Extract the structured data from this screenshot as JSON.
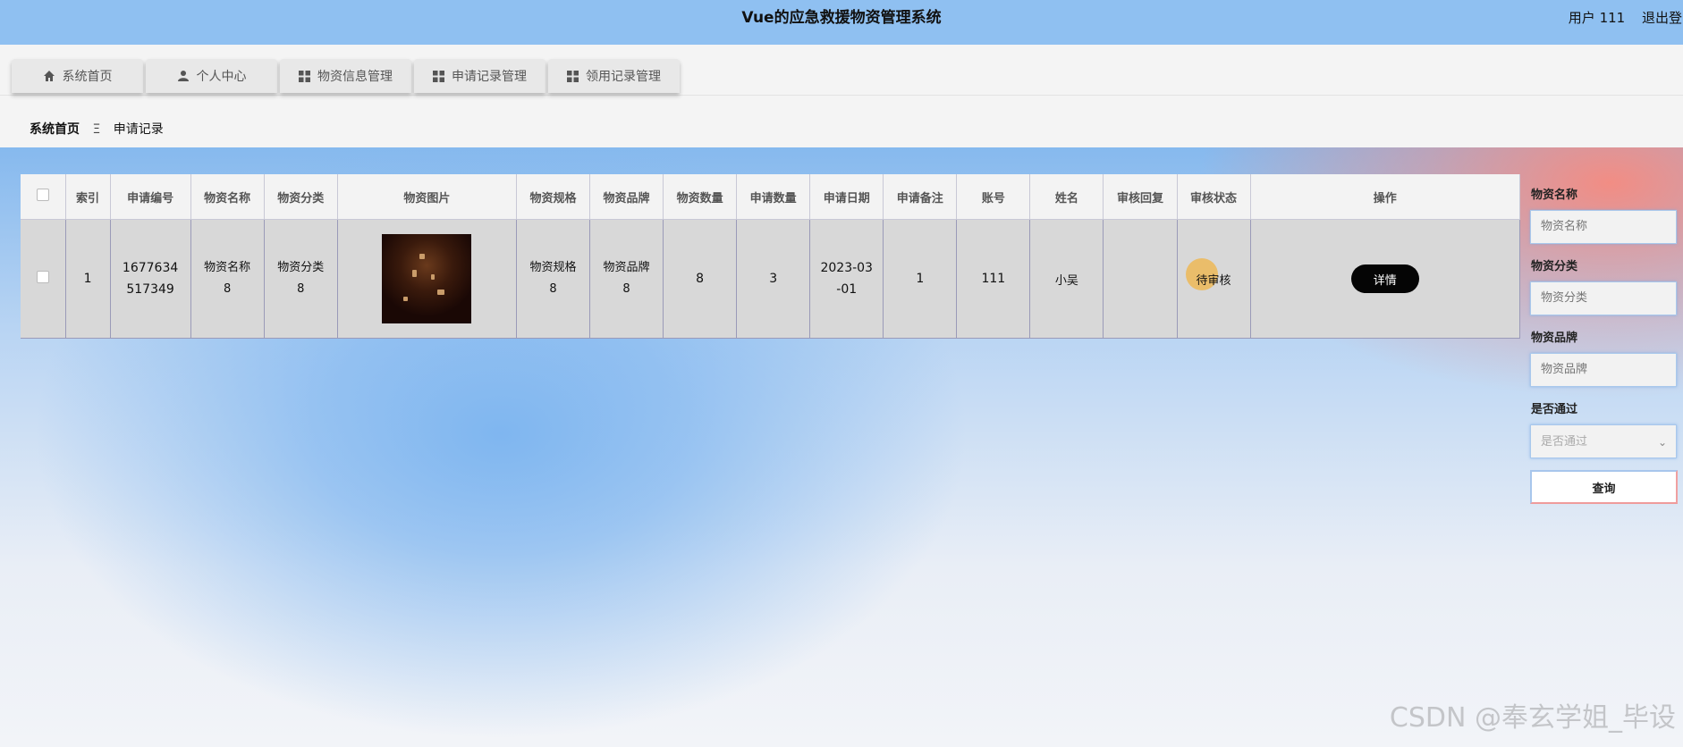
{
  "header": {
    "title": "Vue的应急救援物资管理系统",
    "user_label": "用户 111",
    "logout_label": "退出登录"
  },
  "nav": {
    "items": [
      {
        "label": "系统首页",
        "icon": "home-icon"
      },
      {
        "label": "个人中心",
        "icon": "user-icon"
      },
      {
        "label": "物资信息管理",
        "icon": "grid-icon"
      },
      {
        "label": "申请记录管理",
        "icon": "grid-icon"
      },
      {
        "label": "领用记录管理",
        "icon": "grid-icon"
      }
    ]
  },
  "breadcrumb": {
    "home": "系统首页",
    "separator": "Ξ",
    "current": "申请记录"
  },
  "table": {
    "columns": [
      "索引",
      "申请编号",
      "物资名称",
      "物资分类",
      "物资图片",
      "物资规格",
      "物资品牌",
      "物资数量",
      "申请数量",
      "申请日期",
      "申请备注",
      "账号",
      "姓名",
      "审核回复",
      "审核状态",
      "操作"
    ],
    "rows": [
      {
        "index": "1",
        "apply_no": "1677634517349",
        "name": "物资名称8",
        "category": "物资分类8",
        "spec": "物资规格8",
        "brand": "物资品牌8",
        "quantity": "8",
        "apply_quantity": "3",
        "apply_date": "2023-03-01",
        "remark": "1",
        "account": "111",
        "person": "小吴",
        "reply": "",
        "status": "待审核",
        "action_label": "详情"
      }
    ]
  },
  "search": {
    "name_label": "物资名称",
    "name_placeholder": "物资名称",
    "category_label": "物资分类",
    "category_placeholder": "物资分类",
    "brand_label": "物资品牌",
    "brand_placeholder": "物资品牌",
    "pass_label": "是否通过",
    "pass_placeholder": "是否通过",
    "query_label": "查询"
  },
  "watermark": "CSDN @奉玄学姐_毕设",
  "colors": {
    "header_bg": "#8fc0f1",
    "detail_button": "#050505"
  }
}
